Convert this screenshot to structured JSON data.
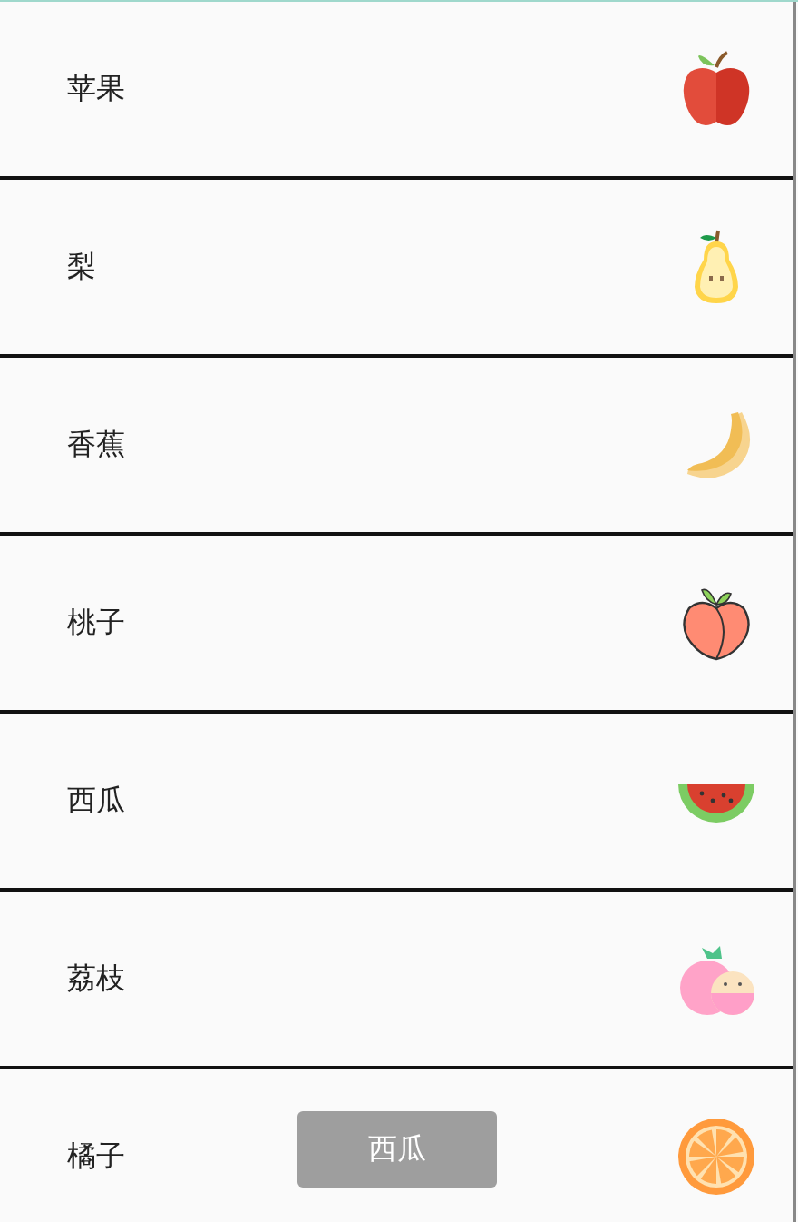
{
  "fruits": [
    {
      "name": "苹果",
      "kind": "apple"
    },
    {
      "name": "梨",
      "kind": "pear"
    },
    {
      "name": "香蕉",
      "kind": "banana"
    },
    {
      "name": "桃子",
      "kind": "peach"
    },
    {
      "name": "西瓜",
      "kind": "watermelon"
    },
    {
      "name": "荔枝",
      "kind": "lychee"
    },
    {
      "name": "橘子",
      "kind": "orange"
    }
  ],
  "toast": "西瓜"
}
